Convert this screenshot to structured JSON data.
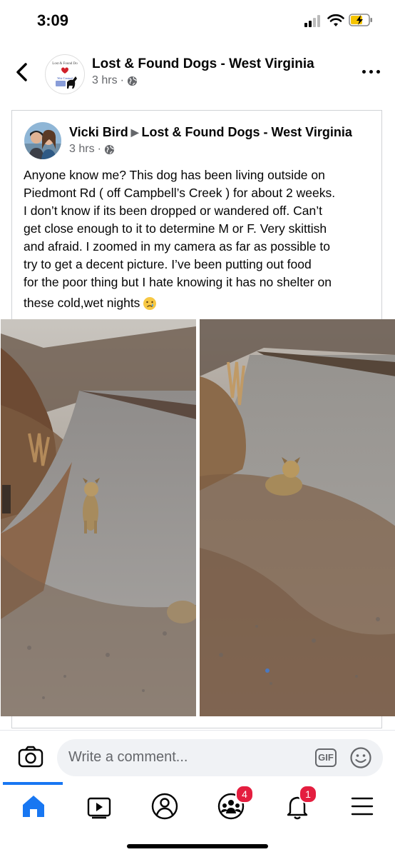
{
  "status_bar": {
    "time": "3:09"
  },
  "header": {
    "page_name": "Lost & Found Dogs - West Virginia",
    "time": "3 hrs",
    "separator": "·"
  },
  "post": {
    "author": "Vicki Bird",
    "target_page": "Lost & Found Dogs - West Virginia",
    "time": "3 hrs",
    "separator": "·",
    "lines": [
      "Anyone know me? This dog has been living outside on",
      "Piedmont Rd ( off Campbell’s Creek ) for about 2 weeks.",
      "I don’t know if its been dropped or wandered off. Can’t",
      "get close enough to it to determine M or F. Very skittish",
      "and afraid. I zoomed in my camera as far as possible to",
      "try to get a decent picture.  I’ve been putting out food",
      "for the poor thing but I hate knowing it has no shelter on",
      "these cold,wet nights"
    ]
  },
  "comment_bar": {
    "placeholder": "Write a comment...",
    "gif_label": "GIF"
  },
  "nav": {
    "items": [
      {
        "icon": "home-icon",
        "active": true
      },
      {
        "icon": "video-icon"
      },
      {
        "icon": "profile-icon"
      },
      {
        "icon": "groups-icon",
        "badge": "4"
      },
      {
        "icon": "bell-icon",
        "badge": "1"
      },
      {
        "icon": "menu-icon"
      }
    ]
  },
  "colors": {
    "accent": "#1877f2",
    "badge": "#e41e3f",
    "meta_text": "#65676b"
  }
}
